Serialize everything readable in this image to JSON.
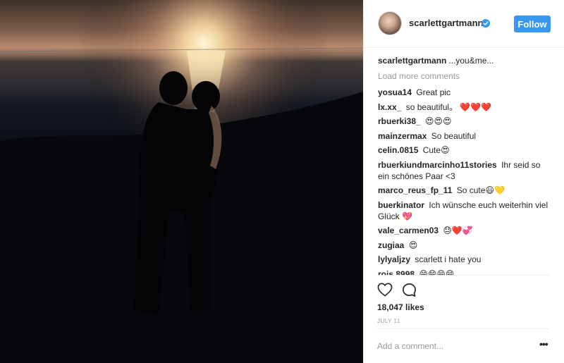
{
  "post": {
    "username": "scarlettgartmann",
    "follow_label": "Follow",
    "caption": {
      "user": "scarlettgartmann",
      "text": "...you&me..."
    },
    "load_more": "Load more comments",
    "comments": [
      {
        "user": "yosua14",
        "text": "Great pic"
      },
      {
        "user": "lx.xx_",
        "text": "so beautiful。 ❤️❤️❤️"
      },
      {
        "user": "rbuerki38_",
        "text": "😍😍😍"
      },
      {
        "user": "mainzermax",
        "text": "So beautiful"
      },
      {
        "user": "celin.0815",
        "text": "Cute😍"
      },
      {
        "user": "rbuerkiundmarcinho11stories",
        "text": "Ihr seid so ein schönes Paar <3"
      },
      {
        "user": "marco_reus_fp_11",
        "text": "So cute😃💛"
      },
      {
        "user": "buerkinator",
        "text": "Ich wünsche euch weiterhin viel Glück 💖"
      },
      {
        "user": "vale_carmen03",
        "text": "😓❤️💞"
      },
      {
        "user": "zugiaa",
        "text": "😍"
      },
      {
        "user": "lylyaljzy",
        "text": "scarlett i hate you"
      },
      {
        "user": "rois.8998",
        "text": "😁😁😁😁"
      }
    ],
    "likes": "18,047 likes",
    "date": "JULY 11",
    "add_comment_placeholder": "Add a comment..."
  },
  "icons": {
    "verified": "verified-badge-icon",
    "like": "heart-icon",
    "comment": "comment-bubble-icon",
    "more": "more-options-icon"
  },
  "colors": {
    "accent": "#3897f0",
    "text": "#262626",
    "muted": "#999999",
    "divider": "#efefef"
  }
}
